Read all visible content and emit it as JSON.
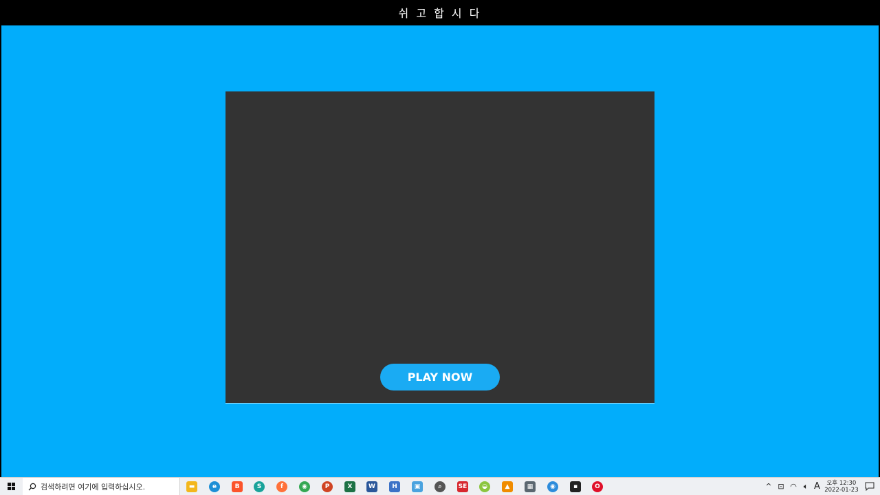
{
  "window": {
    "title": "쉬 고 합 시 다"
  },
  "game": {
    "play_label": "PLAY NOW"
  },
  "taskbar": {
    "search_placeholder": "검색하려면 여기에 입력하십시오.",
    "apps": [
      {
        "name": "file-explorer-icon",
        "glyph": "▬",
        "color": "#f3b71c",
        "round": false
      },
      {
        "name": "edge-icon",
        "glyph": "e",
        "color": "#1d8fd6",
        "round": true
      },
      {
        "name": "brave-icon",
        "glyph": "B",
        "color": "#fb542b",
        "round": false
      },
      {
        "name": "teams-icon",
        "glyph": "S",
        "color": "#1aa39a",
        "round": true
      },
      {
        "name": "firefox-icon",
        "glyph": "f",
        "color": "#ff7139",
        "round": true
      },
      {
        "name": "chrome-icon",
        "glyph": "◉",
        "color": "#34a853",
        "round": true
      },
      {
        "name": "powerpoint-icon",
        "glyph": "P",
        "color": "#d04423",
        "round": true
      },
      {
        "name": "excel-icon",
        "glyph": "X",
        "color": "#1d7145",
        "round": false
      },
      {
        "name": "word-icon",
        "glyph": "W",
        "color": "#2b579a",
        "round": false
      },
      {
        "name": "hangul-icon",
        "glyph": "H",
        "color": "#3c72c7",
        "round": false
      },
      {
        "name": "remote-desktop-icon",
        "glyph": "▣",
        "color": "#4aa3df",
        "round": false
      },
      {
        "name": "search-tool-icon",
        "glyph": "⌕",
        "color": "#555555",
        "round": true
      },
      {
        "name": "se-app-icon",
        "glyph": "SE",
        "color": "#d7282f",
        "round": false
      },
      {
        "name": "android-app-icon",
        "glyph": "◒",
        "color": "#8cc63f",
        "round": true
      },
      {
        "name": "vlc-icon",
        "glyph": "▲",
        "color": "#f08c00",
        "round": false
      },
      {
        "name": "calculator-icon",
        "glyph": "▦",
        "color": "#5b6770",
        "round": false
      },
      {
        "name": "chromium-icon",
        "glyph": "◉",
        "color": "#2d8cdb",
        "round": true
      },
      {
        "name": "sticky-notes-icon",
        "glyph": "▪",
        "color": "#222222",
        "round": false
      },
      {
        "name": "opera-icon",
        "glyph": "O",
        "color": "#e0102a",
        "round": true
      }
    ],
    "ime_indicator": "A",
    "clock_time": "오후 12:30",
    "clock_date": "2022-01-23"
  }
}
